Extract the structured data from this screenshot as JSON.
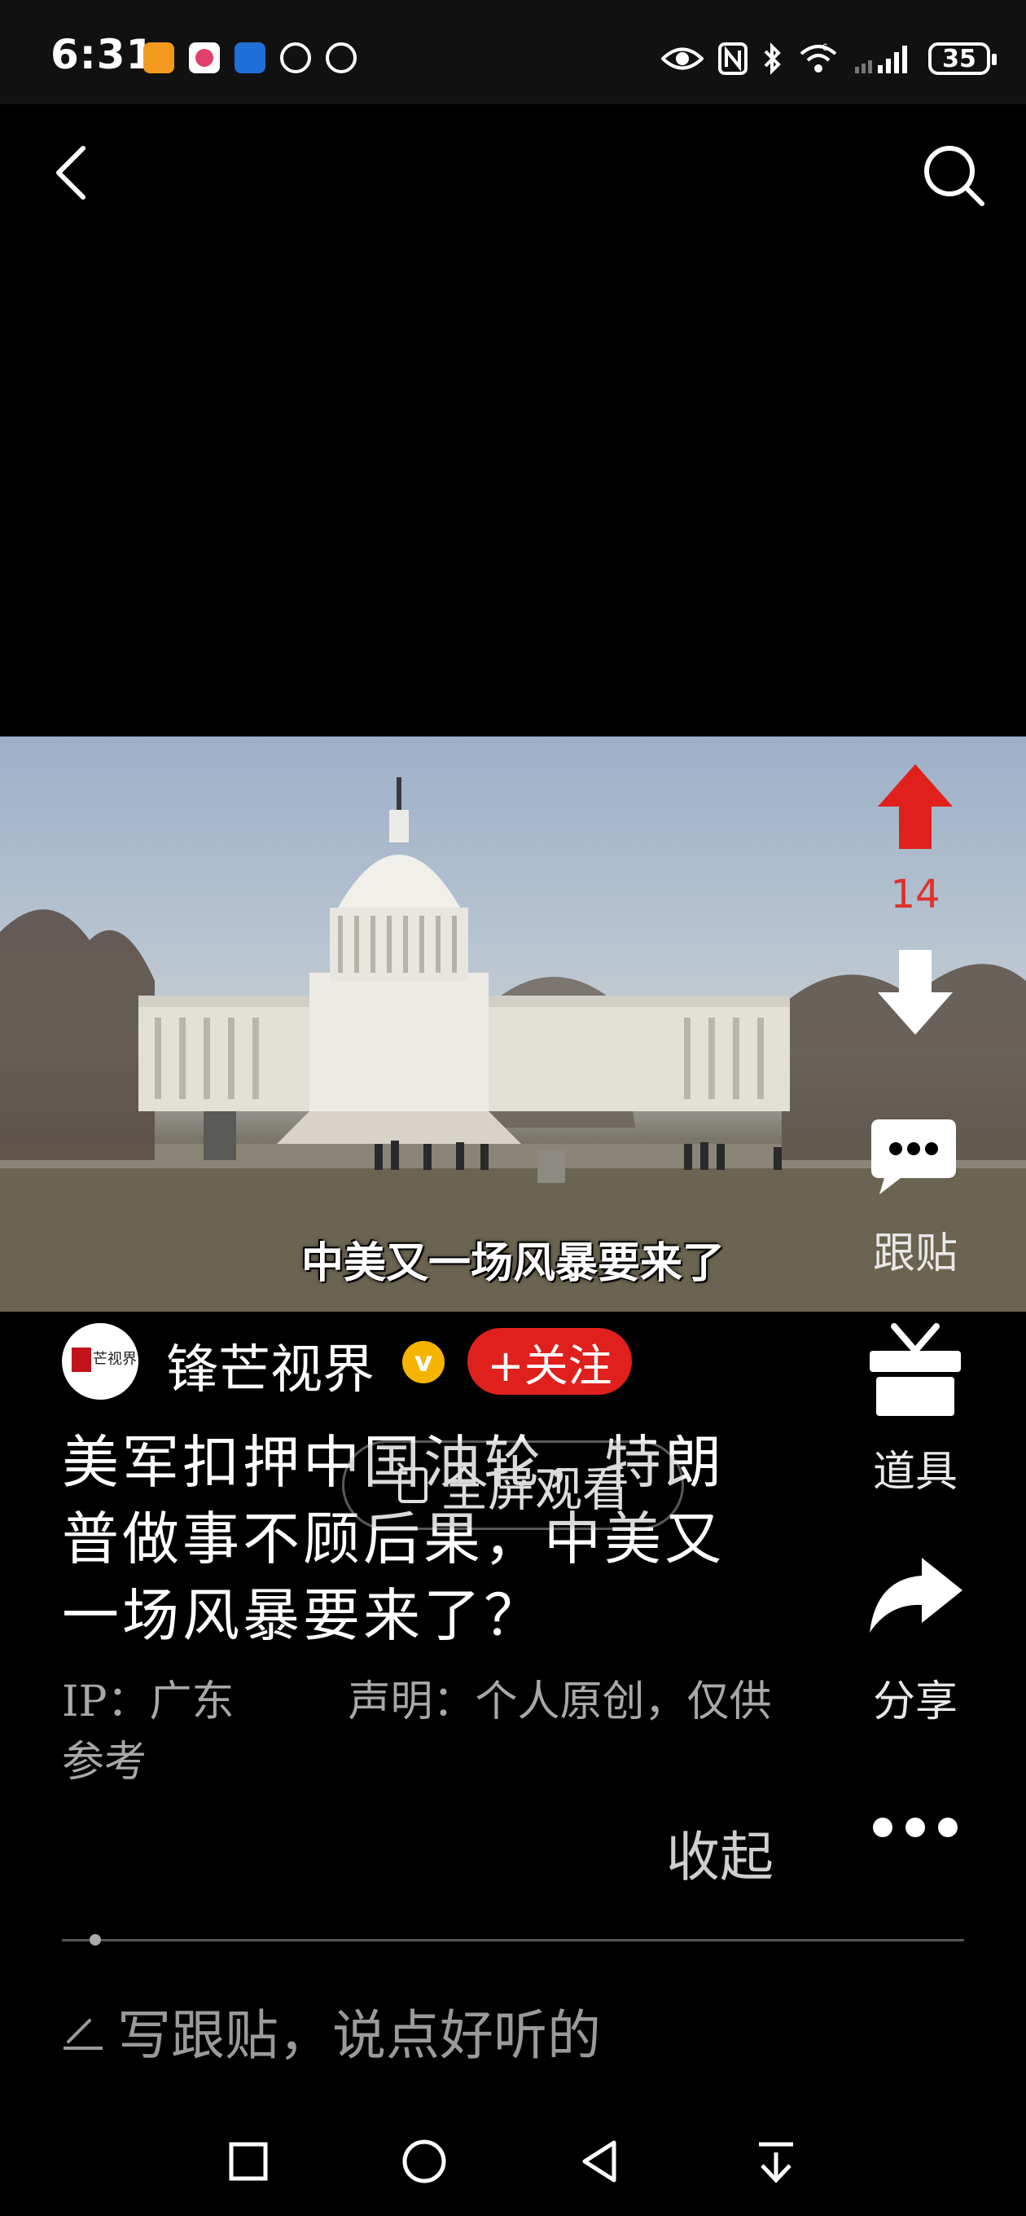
{
  "status_bar": {
    "time": "6:31",
    "battery": "35",
    "network": "6"
  },
  "video": {
    "subtitle": "中美又一场风暴要来了"
  },
  "actions": {
    "upvote_count": "14",
    "reply_label": "跟贴",
    "props_label": "道具",
    "share_label": "分享"
  },
  "author": {
    "avatar_text": "芒视界",
    "name": "锋芒视界",
    "verified_mark": "v",
    "follow_label": "+关注"
  },
  "post": {
    "title": "美军扣押中国油轮，特朗普做事不顾后果，中美又一场风暴要来了？",
    "fullscreen_label": "全屏观看",
    "ip": "IP：广东",
    "statement": "声明：个人原创，仅供参考",
    "collapse_label": "收起"
  },
  "comment": {
    "placeholder": "写跟贴，说点好听的"
  },
  "colors": {
    "accent_red": "#e0201c",
    "verified_gold": "#f5b400"
  }
}
